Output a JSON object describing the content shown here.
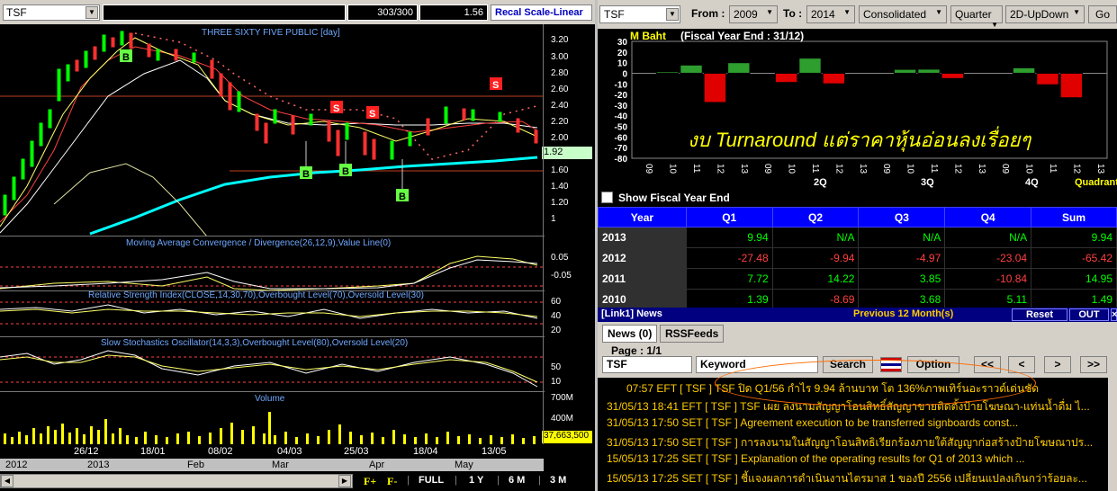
{
  "left": {
    "symbol": "TSF",
    "counter": "303/300",
    "field_value": "1.56",
    "recal_label": "Recal Scale-Linear",
    "chart_title": "THREE SIXTY FIVE PUBLIC [day]",
    "price_labels": [
      "3.20",
      "3.00",
      "2.80",
      "2.60",
      "2.40",
      "2.20",
      "2.00",
      "1.80",
      "1.60",
      "1.40",
      "1.20",
      "1"
    ],
    "current_price": "1.92",
    "macd_label": "Moving Average Convergence / Divergence(26,12,9),Value Line(0)",
    "macd_ticks": [
      "0.05",
      "-0.05"
    ],
    "rsi_label": "Relative Strength Index(CLOSE,14,30,70),Overbought Level(70),Oversold Level(30)",
    "rsi_ticks": [
      "60",
      "40",
      "20"
    ],
    "stoch_label": "Slow Stochastics Oscillator(14,3,3),Overbought Level(80),Oversold Level(20)",
    "stoch_ticks": [
      "50",
      "10"
    ],
    "volume_label": "Volume",
    "volume_ticks": [
      "700M",
      "400M"
    ],
    "current_volume": "37,663,500",
    "dates": [
      "26/12",
      "18/01",
      "08/02",
      "04/03",
      "25/03",
      "18/04",
      "13/05"
    ],
    "months": [
      "2012",
      "2013",
      "Feb",
      "Mar",
      "Apr",
      "May"
    ],
    "buttons": {
      "f_plus": "F+",
      "f_minus": "F-",
      "full": "FULL",
      "one_y": "1 Y",
      "six_m": "6 M",
      "three_m": "3 M"
    },
    "signals": [
      "B",
      "S",
      "S",
      "S",
      "B",
      "B",
      "B",
      "S"
    ]
  },
  "right": {
    "symbol": "TSF",
    "from_label": "From :",
    "from_value": "2009",
    "to_label": "To :",
    "to_value": "2014",
    "consolidated": "Consolidated",
    "period": "Quarter",
    "chart_mode": "2D-UpDown",
    "go_label": "Go",
    "unit_label": "M Baht",
    "fiscal_label": "(Fiscal Year End : 31/12)",
    "overlay_text": "งบ Turnaround แต่ราคาหุ้นอ่อนลงเรื่อยๆ",
    "show_fy_label": "Show Fiscal Year End",
    "quadrant_label": "Quadrant",
    "group_labels": [
      "2Q",
      "3Q",
      "4Q"
    ],
    "table": {
      "headers": [
        "Year",
        "Q1",
        "Q2",
        "Q3",
        "Q4",
        "Sum"
      ],
      "rows": [
        [
          "2013",
          "9.94",
          "N/A",
          "N/A",
          "N/A",
          "9.94"
        ],
        [
          "2012",
          "-27.48",
          "-9.94",
          "-4.97",
          "-23.04",
          "-65.42"
        ],
        [
          "2011",
          "7.72",
          "14.22",
          "3.85",
          "-10.84",
          "14.95"
        ],
        [
          "2010",
          "1.39",
          "-8.69",
          "3.68",
          "5.11",
          "1.49"
        ]
      ]
    },
    "news": {
      "title": "[Link1] News",
      "previous": "Previous 12 Month(s)",
      "reset": "Reset",
      "out": "OUT",
      "tab_news": "News (0)",
      "tab_rss": "RSSFeeds",
      "page": "Page : 1/1",
      "symbol_field": "TSF",
      "keyword_field": "Keyword",
      "search": "Search",
      "option": "Option",
      "nav": [
        "<<",
        "<",
        ">",
        ">>"
      ],
      "items": [
        "07:57  EFT  [ TSF ]  TSF ปิด Q1/56 กำไร 9.94 ล้านบาท โต 136%ภาพเทิร์นอะราวด์เด่นชัด",
        "31/05/13 18:41  EFT  [ TSF ]  TSF เผย ลงนามสัญญาโอนสิทธิ์สัญญาขายติดตั้งป้ายโฆษณา-แท่นน้ำดื่ม ไ...",
        "31/05/13 17:50  SET  [ TSF ]  Agreement execution to be transferred signboards const...",
        "31/05/13 17:50  SET  [ TSF ]  การลงนามในสัญญาโอนสิทธิเรียกร้องภายใต้สัญญาก่อสร้างป้ายโฆษณาปร...",
        "15/05/13 17:25  SET  [ TSF ]  Explanation of the operating results for Q1 of 2013 which ...",
        "15/05/13 17:25  SET  [ TSF ]  ชี้แจงผลการดำเนินงานไตรมาส 1 ของปี 2556 เปลี่ยนแปลงเกินกว่าร้อยละ..."
      ]
    }
  },
  "chart_data": {
    "type": "bar",
    "title": "M Baht",
    "subtitle": "(Fiscal Year End : 31/12)",
    "ylim": [
      -80,
      30
    ],
    "yticks": [
      "30",
      "20",
      "10",
      "0",
      "-10",
      "-20",
      "-30",
      "-40",
      "-50",
      "-60",
      "-70",
      "-80"
    ],
    "categories": [
      "Q1 2010",
      "Q1 2011",
      "Q1 2012",
      "Q1 2013",
      "Q2 2010",
      "Q2 2011",
      "Q2 2012",
      "Q3 2010",
      "Q3 2011",
      "Q3 2012",
      "Q4 2010",
      "Q4 2011",
      "Q4 2012"
    ],
    "xticks": [
      "09",
      "10",
      "11",
      "12",
      "13",
      "09",
      "10",
      "11",
      "12",
      "13",
      "09",
      "10",
      "11",
      "12",
      "13",
      "09",
      "10",
      "11",
      "12",
      "13"
    ],
    "values": [
      1.39,
      7.72,
      -27.48,
      9.94,
      -8.69,
      14.22,
      -9.94,
      3.68,
      3.85,
      -4.97,
      5.11,
      -10.84,
      -23.04
    ],
    "colors": {
      "positive": "#2e9e2e",
      "negative": "#e00000"
    }
  }
}
